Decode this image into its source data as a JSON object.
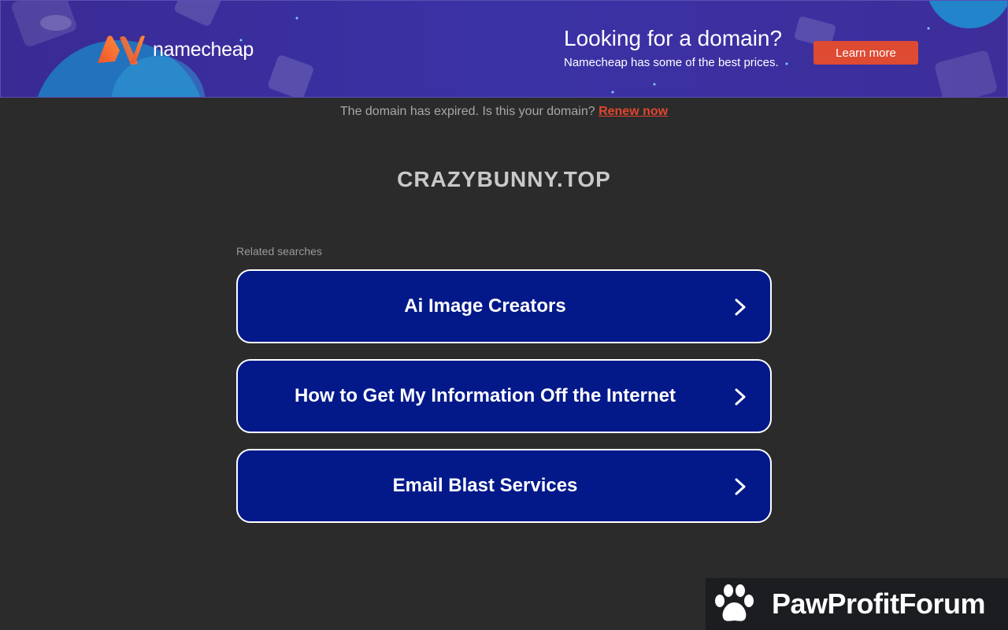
{
  "banner": {
    "brand": "namecheap",
    "promo_title": "Looking for a domain?",
    "promo_subtitle": "Namecheap has some of the best prices.",
    "cta_label": "Learn more",
    "accent_color": "#de4a32",
    "background_color": "#3b2d9e"
  },
  "notice": {
    "text": "The domain has expired. Is this your domain?",
    "link_label": "Renew now"
  },
  "domain": "CRAZYBUNNY.TOP",
  "related": {
    "label": "Related searches",
    "items": [
      {
        "label": "Ai Image Creators",
        "icon": "chevron-right-icon"
      },
      {
        "label": "How to Get My Information Off the Internet",
        "icon": "chevron-right-icon"
      },
      {
        "label": "Email Blast Services",
        "icon": "chevron-right-icon"
      }
    ]
  },
  "watermark": {
    "text": "PawProfitForum",
    "icon": "paw-icon"
  },
  "colors": {
    "page_background": "#2b2b2b",
    "button_background": "#03198a",
    "link_color": "#e0462f"
  }
}
